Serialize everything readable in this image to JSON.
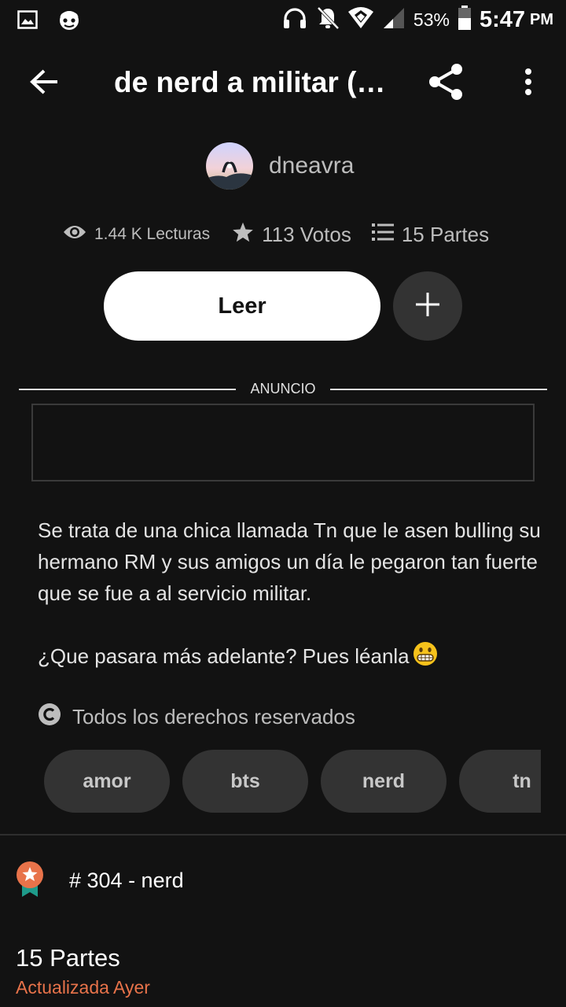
{
  "status_bar": {
    "battery": "53%",
    "time": "5:47",
    "ampm": "PM",
    "icons": [
      "image-icon",
      "app-notification-icon",
      "headphones-icon",
      "notifications-off-icon",
      "wifi-icon",
      "signal-icon",
      "battery-icon"
    ]
  },
  "app_bar": {
    "title": "de nerd a militar (…",
    "icons": [
      "back-arrow-icon",
      "share-icon",
      "more-vert-icon"
    ]
  },
  "author": {
    "name": "dneavra"
  },
  "stats": {
    "reads": "1.44 K Lecturas",
    "votes": "113 Votos",
    "parts": "15 Partes"
  },
  "actions": {
    "read_label": "Leer",
    "add_icon": "plus-icon"
  },
  "ad": {
    "label": "ANUNCIO"
  },
  "description": {
    "paragraph1": "Se trata de una chica llamada Tn que le asen bulling su hermano RM y sus amigos un día le pegaron tan fuerte que se fue a al servicio militar.",
    "paragraph2": "¿Que pasara más adelante? Pues léanla"
  },
  "copyright": {
    "text": "Todos los derechos reservados"
  },
  "tags": [
    "amor",
    "bts",
    "nerd",
    "tn"
  ],
  "ranking": {
    "text": "# 304 - nerd"
  },
  "parts": {
    "title": "15 Partes",
    "updated": "Actualizada Ayer"
  },
  "colors": {
    "background": "#121212",
    "accent_orange": "#e8734a",
    "button_white": "#ffffff",
    "chip_gray": "#333333"
  }
}
